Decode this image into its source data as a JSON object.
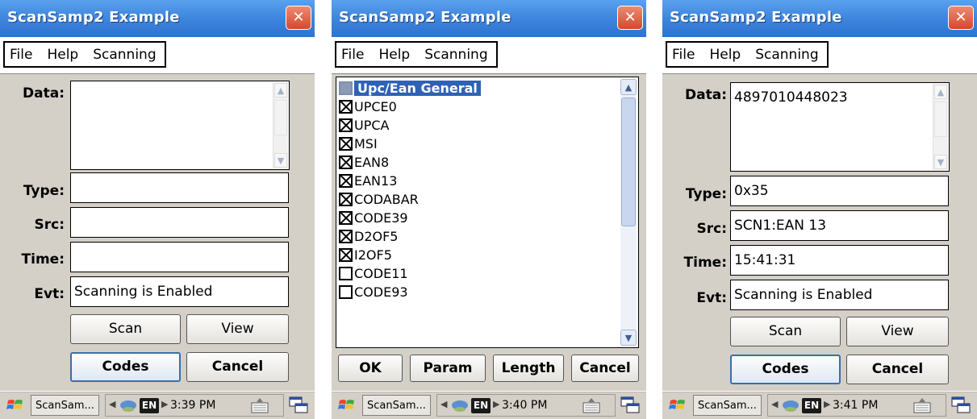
{
  "screens": [
    {
      "title": "ScanSamp2 Example",
      "close_label": "✕",
      "menu": [
        "File",
        "Help",
        "Scanning"
      ],
      "labels": {
        "data": "Data:",
        "type": "Type:",
        "src": "Src:",
        "time": "Time:",
        "evt": "Evt:"
      },
      "values": {
        "data": "",
        "type": "",
        "src": "",
        "time": "",
        "evt": "Scanning is Enabled"
      },
      "buttons": {
        "scan": "Scan",
        "view": "View",
        "codes": "Codes",
        "cancel": "Cancel"
      },
      "taskbar": {
        "task": "ScanSam...",
        "lang": "EN",
        "clock": "3:39 PM"
      }
    },
    {
      "title": "ScanSamp2 Example",
      "close_label": "✕",
      "menu": [
        "File",
        "Help",
        "Scanning"
      ],
      "list": [
        {
          "label": "Upc/Ean General",
          "checked": false,
          "selected": true
        },
        {
          "label": "UPCE0",
          "checked": true
        },
        {
          "label": "UPCA",
          "checked": true
        },
        {
          "label": "MSI",
          "checked": true
        },
        {
          "label": "EAN8",
          "checked": true
        },
        {
          "label": "EAN13",
          "checked": true
        },
        {
          "label": "CODABAR",
          "checked": true
        },
        {
          "label": "CODE39",
          "checked": true
        },
        {
          "label": "D2OF5",
          "checked": true
        },
        {
          "label": "I2OF5",
          "checked": true
        },
        {
          "label": "CODE11",
          "checked": false
        },
        {
          "label": "CODE93",
          "checked": false
        }
      ],
      "buttons": {
        "ok": "OK",
        "param": "Param",
        "length": "Length",
        "cancel": "Cancel"
      },
      "taskbar": {
        "task": "ScanSam...",
        "lang": "EN",
        "clock": "3:40 PM"
      }
    },
    {
      "title": "ScanSamp2 Example",
      "close_label": "✕",
      "menu": [
        "File",
        "Help",
        "Scanning"
      ],
      "labels": {
        "data": "Data:",
        "type": "Type:",
        "src": "Src:",
        "time": "Time:",
        "evt": "Evt:"
      },
      "values": {
        "data": "4897010448023",
        "type": "0x35",
        "src": "SCN1:EAN 13",
        "time": "15:41:31",
        "evt": "Scanning is Enabled"
      },
      "buttons": {
        "scan": "Scan",
        "view": "View",
        "codes": "Codes",
        "cancel": "Cancel"
      },
      "taskbar": {
        "task": "ScanSam...",
        "lang": "EN",
        "clock": "3:41 PM"
      }
    }
  ],
  "colors": {
    "title_bar": "#3b83dc",
    "close_button": "#d14a2c",
    "selection": "#2e62b5",
    "dialog_bg": "#d4d0c8"
  }
}
